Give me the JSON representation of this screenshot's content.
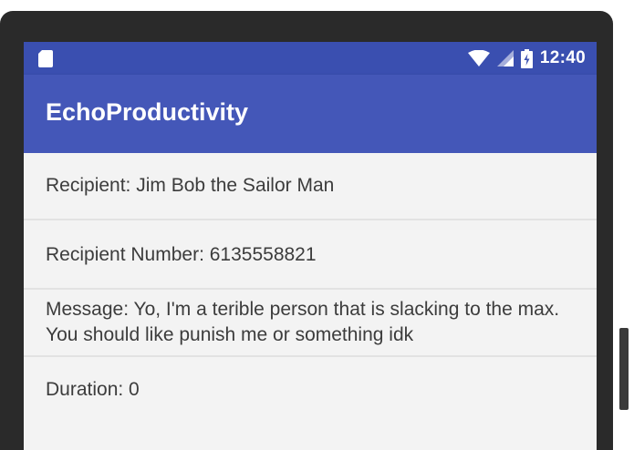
{
  "status_bar": {
    "time": "12:40",
    "icons": [
      "sd-card-icon",
      "wifi-icon",
      "cell-signal-icon",
      "battery-icon"
    ]
  },
  "app_bar": {
    "title": "EchoProductivity"
  },
  "details": {
    "recipient": "Recipient: Jim Bob the Sailor Man",
    "recipient_number": "Recipient Number: 6135558821",
    "message": "Message: Yo, I'm a terible person that is slacking to the max. You should like punish me or something idk",
    "duration": "Duration: 0"
  },
  "colors": {
    "status_bar": "#3a4fb0",
    "app_bar": "#4457b8",
    "background": "#f3f3f3",
    "text": "#3c3c3c"
  }
}
